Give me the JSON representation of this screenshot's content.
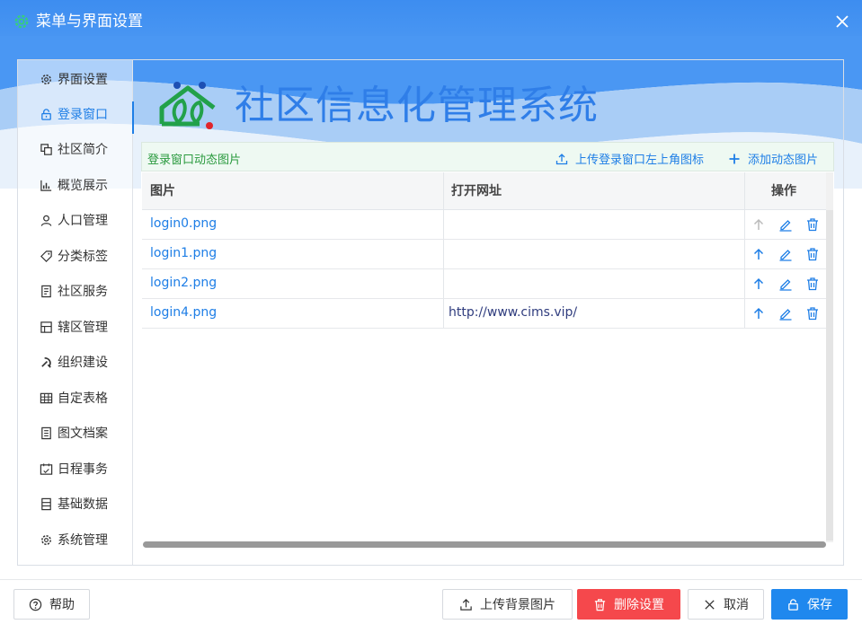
{
  "window": {
    "title": "菜单与界面设置"
  },
  "sidebar": {
    "items": [
      {
        "label": "界面设置",
        "icon": "gear-icon"
      },
      {
        "label": "登录窗口",
        "icon": "lock-icon",
        "active": true
      },
      {
        "label": "社区简介",
        "icon": "copy-icon"
      },
      {
        "label": "概览展示",
        "icon": "bar-chart-icon"
      },
      {
        "label": "人口管理",
        "icon": "user-icon"
      },
      {
        "label": "分类标签",
        "icon": "tag-icon"
      },
      {
        "label": "社区服务",
        "icon": "service-icon"
      },
      {
        "label": "辖区管理",
        "icon": "district-icon"
      },
      {
        "label": "组织建设",
        "icon": "party-icon"
      },
      {
        "label": "自定表格",
        "icon": "table-icon"
      },
      {
        "label": "图文档案",
        "icon": "document-icon"
      },
      {
        "label": "日程事务",
        "icon": "calendar-icon"
      },
      {
        "label": "基础数据",
        "icon": "database-icon"
      },
      {
        "label": "系统管理",
        "icon": "gear-icon"
      }
    ]
  },
  "banner": {
    "app_title": "社区信息化管理系统"
  },
  "panel": {
    "title": "登录窗口动态图片",
    "upload_icon_label": "上传登录窗口左上角图标",
    "add_image_label": "添加动态图片"
  },
  "table": {
    "columns": [
      "图片",
      "打开网址",
      "操作"
    ],
    "rows": [
      {
        "file": "login0.png",
        "url": ""
      },
      {
        "file": "login1.png",
        "url": ""
      },
      {
        "file": "login2.png",
        "url": ""
      },
      {
        "file": "login4.png",
        "url": "http://www.cims.vip/"
      }
    ]
  },
  "footer": {
    "help_label": "帮助",
    "upload_bg_label": "上传背景图片",
    "delete_label": "删除设置",
    "cancel_label": "取消",
    "save_label": "保存"
  },
  "colors": {
    "titlebar": "#3d8df0",
    "accent": "#1e7ee6",
    "danger": "#f5484c",
    "primary": "#1f88ee",
    "panel_title": "#2a9a3e"
  }
}
